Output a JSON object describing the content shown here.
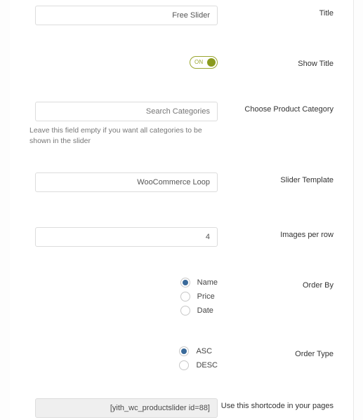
{
  "fields": {
    "title": {
      "label": "Title",
      "value": "Free Slider"
    },
    "show_title": {
      "label": "Show Title",
      "state_text": "ON"
    },
    "category": {
      "label": "Choose Product Category",
      "placeholder": "Search Categories",
      "helper": "Leave this field empty if you want all categories to be shown in the slider"
    },
    "template": {
      "label": "Slider Template",
      "value": "WooCommerce Loop"
    },
    "images_per_row": {
      "label": "Images per row",
      "value": "4"
    },
    "order_by": {
      "label": "Order By",
      "options": [
        "Name",
        "Price",
        "Date"
      ],
      "selected": "Name"
    },
    "order_type": {
      "label": "Order Type",
      "options": [
        "ASC",
        "DESC"
      ],
      "selected": "ASC"
    },
    "shortcode": {
      "label": "Use this shortcode in your pages",
      "value": "[yith_wc_productslider id=88]"
    }
  }
}
